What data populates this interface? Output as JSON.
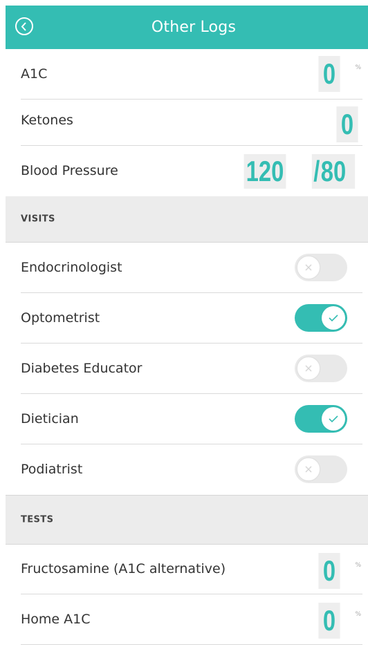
{
  "header": {
    "title": "Other Logs",
    "back_icon": "back-arrow-circle-icon"
  },
  "measurements": {
    "a1c": {
      "label": "A1C",
      "value": "0",
      "unit": "%"
    },
    "ketones": {
      "label": "Ketones",
      "value": "0"
    },
    "blood_pressure": {
      "label": "Blood Pressure",
      "systolic": "120",
      "separator": "/",
      "diastolic": "80"
    }
  },
  "visits": {
    "section_title": "VISITS",
    "items": [
      {
        "label": "Endocrinologist",
        "enabled": false
      },
      {
        "label": "Optometrist",
        "enabled": true
      },
      {
        "label": "Diabetes Educator",
        "enabled": false
      },
      {
        "label": "Dietician",
        "enabled": true
      },
      {
        "label": "Podiatrist",
        "enabled": false
      }
    ]
  },
  "tests": {
    "section_title": "TESTS",
    "items": [
      {
        "label": "Fructosamine (A1C alternative)",
        "value": "0",
        "unit": "%"
      },
      {
        "label": "Home A1C",
        "value": "0",
        "unit": "%"
      }
    ]
  },
  "colors": {
    "accent": "#34bdb3",
    "section_bg": "#ececec",
    "toggle_off": "#e9e9e9"
  }
}
